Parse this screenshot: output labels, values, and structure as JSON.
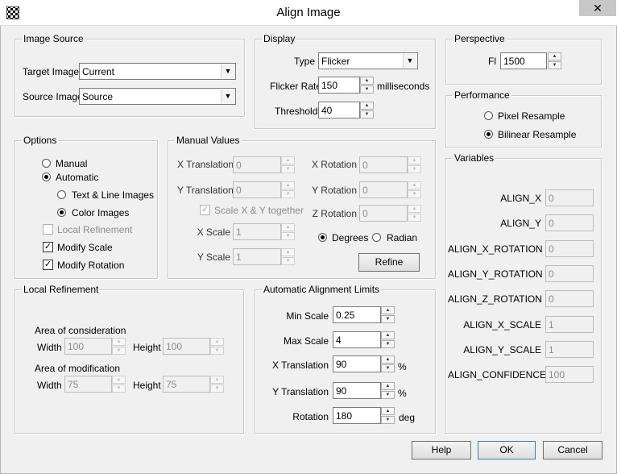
{
  "window": {
    "title": "Align Image",
    "close": "✕"
  },
  "image_source": {
    "legend": "Image Source",
    "target_label": "Target Image",
    "target_value": "Current",
    "source_label": "Source Image",
    "source_value": "Source"
  },
  "display": {
    "legend": "Display",
    "type_label": "Type",
    "type_value": "Flicker",
    "flicker_label": "Flicker Rate",
    "flicker_value": "150",
    "flicker_unit": "milliseconds",
    "threshold_label": "Threshold",
    "threshold_value": "40"
  },
  "perspective": {
    "legend": "Perspective",
    "fl_label": "Fl",
    "fl_value": "1500"
  },
  "performance": {
    "legend": "Performance",
    "pixel": "Pixel Resample",
    "bilinear": "Bilinear Resample",
    "selected": "bilinear"
  },
  "options": {
    "legend": "Options",
    "manual": "Manual",
    "automatic": "Automatic",
    "text_line": "Text & Line Images",
    "color_images": "Color Images",
    "local_refinement": "Local Refinement",
    "modify_scale": "Modify Scale",
    "modify_rotation": "Modify Rotation"
  },
  "manual_values": {
    "legend": "Manual Values",
    "x_translation": "X Translation",
    "x_translation_value": "0",
    "y_translation": "Y Translation",
    "y_translation_value": "0",
    "scale_together": "Scale X & Y together",
    "x_scale": "X Scale",
    "x_scale_value": "1",
    "y_scale": "Y Scale",
    "y_scale_value": "1",
    "x_rotation": "X Rotation",
    "x_rotation_value": "0",
    "y_rotation": "Y Rotation",
    "y_rotation_value": "0",
    "z_rotation": "Z Rotation",
    "z_rotation_value": "0",
    "degrees": "Degrees",
    "radian": "Radian",
    "refine": "Refine"
  },
  "variables": {
    "legend": "Variables",
    "items": [
      {
        "name": "ALIGN_X",
        "value": "0"
      },
      {
        "name": "ALIGN_Y",
        "value": "0"
      },
      {
        "name": "ALIGN_X_ROTATION",
        "value": "0"
      },
      {
        "name": "ALIGN_Y_ROTATION",
        "value": "0"
      },
      {
        "name": "ALIGN_Z_ROTATION",
        "value": "0"
      },
      {
        "name": "ALIGN_X_SCALE",
        "value": "1"
      },
      {
        "name": "ALIGN_Y_SCALE",
        "value": "1"
      },
      {
        "name": "ALIGN_CONFIDENCE",
        "value": "100"
      }
    ]
  },
  "local_refinement": {
    "legend": "Local Refinement",
    "consideration": "Area of consideration",
    "modification": "Area of modification",
    "width": "Width",
    "height": "Height",
    "cons_width": "100",
    "cons_height": "100",
    "mod_width": "75",
    "mod_height": "75"
  },
  "auto_limits": {
    "legend": "Automatic Alignment Limits",
    "min_scale": "Min Scale",
    "min_scale_value": "0.25",
    "max_scale": "Max Scale",
    "max_scale_value": "4",
    "x_translation": "X Translation",
    "x_translation_value": "90",
    "x_unit": "%",
    "y_translation": "Y Translation",
    "y_translation_value": "90",
    "y_unit": "%",
    "rotation": "Rotation",
    "rotation_value": "180",
    "rotation_unit": "deg"
  },
  "buttons": {
    "help": "Help",
    "ok": "OK",
    "cancel": "Cancel"
  }
}
